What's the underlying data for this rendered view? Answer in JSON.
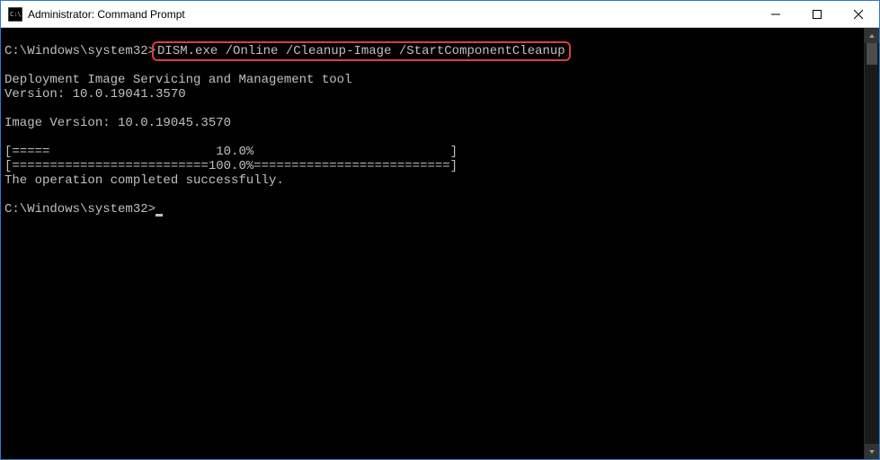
{
  "window": {
    "title": "Administrator: Command Prompt"
  },
  "console": {
    "prompt1_prefix": "C:\\Windows\\system32>",
    "command": "DISM.exe /Online /Cleanup-Image /StartComponentCleanup",
    "output_line1": "Deployment Image Servicing and Management tool",
    "output_line2": "Version: 10.0.19041.3570",
    "output_line3": "Image Version: 10.0.19045.3570",
    "progress_line1": "[=====                      10.0%                          ]",
    "progress_line2": "[==========================100.0%==========================]",
    "output_done": "The operation completed successfully.",
    "prompt2": "C:\\Windows\\system32>"
  },
  "controls": {
    "minimize": "—",
    "maximize": "☐",
    "close": "✕"
  }
}
